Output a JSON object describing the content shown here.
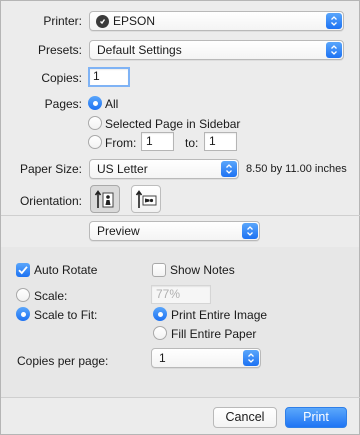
{
  "printer": {
    "label": "Printer:",
    "value": "EPSON"
  },
  "presets": {
    "label": "Presets:",
    "value": "Default Settings"
  },
  "copies": {
    "label": "Copies:",
    "value": "1"
  },
  "pages": {
    "label": "Pages:",
    "all_label": "All",
    "selected_label": "Selected Page in Sidebar",
    "from_label": "From:",
    "from_value": "1",
    "to_label": "to:",
    "to_value": "1",
    "selected_option": "All"
  },
  "paper_size": {
    "label": "Paper Size:",
    "value": "US Letter",
    "dimensions": "8.50 by 11.00 inches"
  },
  "orientation": {
    "label": "Orientation:",
    "selected": "portrait"
  },
  "section_popup": {
    "value": "Preview"
  },
  "auto_rotate": {
    "label": "Auto Rotate",
    "checked": true
  },
  "show_notes": {
    "label": "Show Notes",
    "checked": false
  },
  "scale": {
    "label": "Scale:",
    "value": "77%"
  },
  "scale_to_fit": {
    "label": "Scale to Fit:",
    "selected": true,
    "print_entire_label": "Print Entire Image",
    "fill_entire_label": "Fill Entire Paper",
    "fit_option": "Print Entire Image"
  },
  "copies_per_page": {
    "label": "Copies per page:",
    "value": "1"
  },
  "buttons": {
    "cancel": "Cancel",
    "print": "Print"
  },
  "colors": {
    "accent": "#1d72f3",
    "background": "#ececec"
  },
  "icons": [
    "printer-status-icon",
    "popup-stepper-icon",
    "checkmark-icon",
    "portrait-orientation-icon",
    "landscape-orientation-icon"
  ]
}
